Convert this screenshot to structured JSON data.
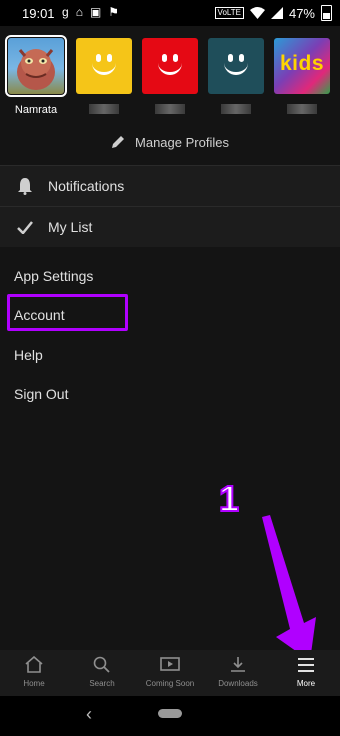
{
  "status_bar": {
    "time": "19:01",
    "left_icons": [
      "g",
      "⌂",
      "▣",
      "⚑"
    ],
    "network": "VoLTE",
    "battery": "47%"
  },
  "profiles": [
    {
      "name": "Namrata",
      "type": "character-avatar",
      "selected": true
    },
    {
      "name": "",
      "type": "smiley",
      "color": "#f5c518"
    },
    {
      "name": "",
      "type": "smiley",
      "color": "#e50914"
    },
    {
      "name": "",
      "type": "smiley",
      "color": "#1f4e5a"
    },
    {
      "name": "",
      "type": "kids",
      "label": "kids"
    }
  ],
  "manage_profiles": "Manage Profiles",
  "menu": {
    "notifications": "Notifications",
    "my_list": "My List"
  },
  "links": {
    "app_settings": "App Settings",
    "account": "Account",
    "help": "Help",
    "sign_out": "Sign Out"
  },
  "annotation": {
    "number": "1",
    "color": "#b000ff"
  },
  "tabs": [
    {
      "label": "Home",
      "icon": "home-icon"
    },
    {
      "label": "Search",
      "icon": "search-icon"
    },
    {
      "label": "Coming Soon",
      "icon": "coming-soon-icon"
    },
    {
      "label": "Downloads",
      "icon": "download-icon"
    },
    {
      "label": "More",
      "icon": "menu-icon",
      "active": true
    }
  ],
  "nav": {
    "back": "‹"
  }
}
